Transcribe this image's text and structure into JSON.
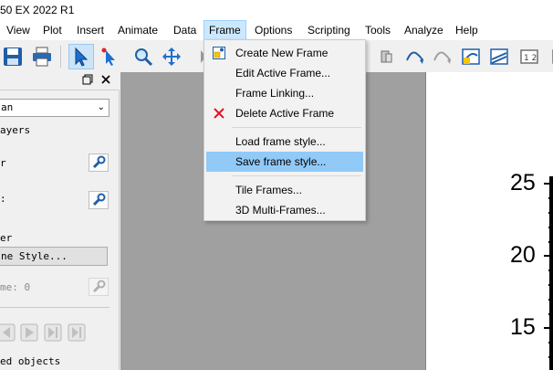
{
  "window": {
    "title": "50 EX 2022 R1"
  },
  "menubar": {
    "items": [
      {
        "label": "View"
      },
      {
        "label": "Plot"
      },
      {
        "label": "Insert"
      },
      {
        "label": "Animate"
      },
      {
        "label": "Data"
      },
      {
        "label": "Frame"
      },
      {
        "label": "Options"
      },
      {
        "label": "Scripting"
      },
      {
        "label": "Tools"
      },
      {
        "label": "Analyze"
      },
      {
        "label": "Help"
      }
    ],
    "active": "Frame"
  },
  "frame_menu": {
    "items": [
      {
        "label": "Create New Frame",
        "icon": "new-frame-icon"
      },
      {
        "label": "Edit Active Frame..."
      },
      {
        "label": "Frame Linking..."
      },
      {
        "label": "Delete Active Frame",
        "icon": "delete-x-icon"
      },
      {
        "label": "Load frame style..."
      },
      {
        "label": "Save frame style...",
        "highlighted": true
      },
      {
        "label": "Tile Frames..."
      },
      {
        "label": "3D Multi-Frames..."
      }
    ]
  },
  "sidebar": {
    "plot_type_value": "an",
    "layers_label": "ayers",
    "row1_label": "r",
    "row2_label": ":",
    "row3_label": "er",
    "frame_style_button": "ne Style...",
    "frame_number_label": "me: 0",
    "bottom_label": "ed objects"
  },
  "plot": {
    "y_ticks": [
      "25",
      "20",
      "15"
    ]
  },
  "colors": {
    "accent_blue": "#0078d7",
    "highlight": "#91c9f7",
    "delete_red": "#e81123",
    "workspace": "#a0a0a0"
  }
}
